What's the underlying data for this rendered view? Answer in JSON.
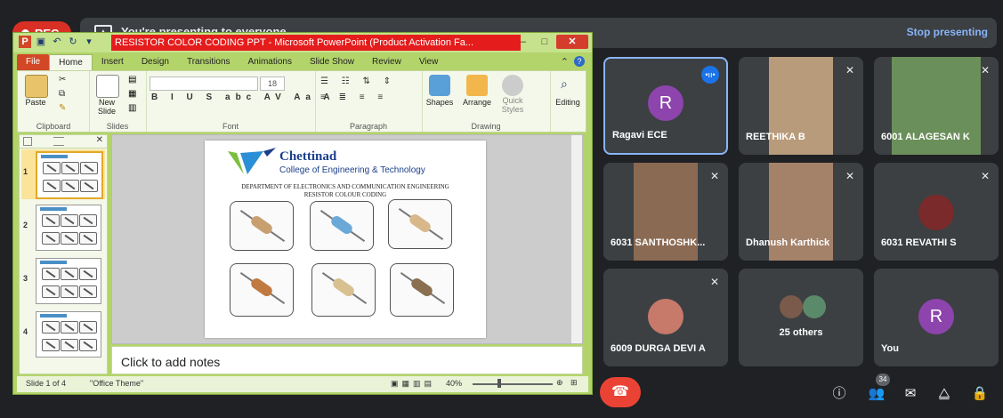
{
  "meet": {
    "rec_label": "REC",
    "presenting_text": "You're presenting to everyone",
    "stop_presenting": "Stop presenting",
    "participant_badge": "34",
    "colors": {
      "bg": "#202124",
      "tile": "#3c4043",
      "accent": "#8ab4f8",
      "end_call": "#ea4335"
    }
  },
  "ppt": {
    "title": "RESISTOR COLOR CODING PPT - Microsoft PowerPoint (Product Activation Fa...",
    "tabs": [
      "File",
      "Home",
      "Insert",
      "Design",
      "Transitions",
      "Animations",
      "Slide Show",
      "Review",
      "View"
    ],
    "active_tab": "Home",
    "ribbon": {
      "paste": "Paste",
      "new_slide": "New\nSlide",
      "font_size": "18",
      "shapes": "Shapes",
      "arrange": "Arrange",
      "quick_styles": "Quick\nStyles",
      "editing": "Editing",
      "groups": [
        "Clipboard",
        "Slides",
        "Font",
        "Paragraph",
        "Drawing"
      ]
    },
    "slide": {
      "brand": "Chettinad",
      "college": "College of Engineering & Technology",
      "department": "DEPARTMENT OF ELECTRONICS AND COMMUNICATION ENGINEERING",
      "subtitle": "RESISTOR COLOUR CODING"
    },
    "thumb_numbers": [
      "1",
      "2",
      "3",
      "4"
    ],
    "notes_placeholder": "Click to add notes",
    "status": {
      "slide_of": "Slide 1 of 4",
      "theme": "\"Office Theme\"",
      "zoom": "40%"
    }
  },
  "participants": [
    {
      "name": "Ragavi ECE",
      "initial": "R",
      "color": "#8e44ad",
      "type": "avatar",
      "active": true
    },
    {
      "name": "REETHIKA B",
      "type": "video",
      "color": "#b89b7a",
      "muted": true
    },
    {
      "name": "6001 ALAGESAN K",
      "type": "video",
      "color": "#6a8f5a",
      "muted": true
    },
    {
      "name": "6031 SANTHOSHK...",
      "type": "video",
      "color": "#8a6a52",
      "muted": true
    },
    {
      "name": "Dhanush Karthick",
      "type": "video",
      "color": "#a4826a",
      "muted": true
    },
    {
      "name": "6031 REVATHI S",
      "type": "photo",
      "color": "#7a2a2a",
      "muted": true
    },
    {
      "name": "6009 DURGA DEVI A",
      "type": "photo",
      "color": "#c77a6a",
      "muted": true
    },
    {
      "name": "25 others",
      "type": "others"
    },
    {
      "name": "You",
      "initial": "R",
      "color": "#8e44ad",
      "type": "avatar"
    }
  ],
  "controls": [
    "info-icon",
    "people-icon",
    "chat-icon",
    "activities-icon",
    "host-controls-icon"
  ]
}
